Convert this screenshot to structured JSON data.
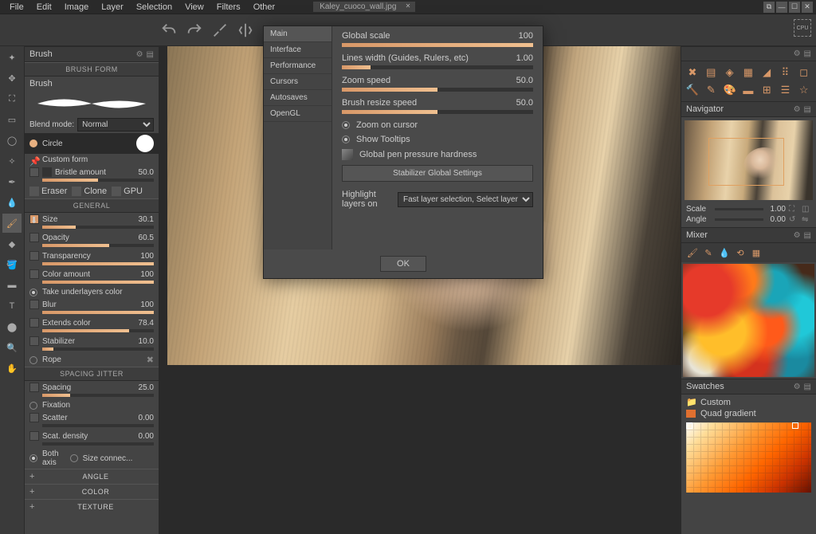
{
  "menu": {
    "items": [
      "File",
      "Edit",
      "Image",
      "Layer",
      "Selection",
      "View",
      "Filters",
      "Other"
    ],
    "tab": "Kaley_cuoco_wall.jpg"
  },
  "leftpanel": {
    "title": "Brush",
    "section_form": "BRUSH FORM",
    "subhead": "Brush",
    "blend_label": "Blend mode:",
    "blend_value": "Normal",
    "type_circle": "Circle",
    "type_custom": "Custom form",
    "bristle_label": "Bristle amount",
    "bristle_value": "50.0",
    "eraser": "Eraser",
    "clone": "Clone",
    "gpu": "GPU",
    "section_general": "GENERAL",
    "size": {
      "label": "Size",
      "value": "30.1",
      "fill": 30
    },
    "opacity": {
      "label": "Opacity",
      "value": "60.5",
      "fill": 60
    },
    "transparency": {
      "label": "Transparency",
      "value": "100",
      "fill": 100
    },
    "coloramount": {
      "label": "Color amount",
      "value": "100",
      "fill": 100
    },
    "take_underlayers": "Take underlayers color",
    "blur": {
      "label": "Blur",
      "value": "100",
      "fill": 100
    },
    "extends": {
      "label": "Extends color",
      "value": "78.4",
      "fill": 78
    },
    "stabilizer": {
      "label": "Stabilizer",
      "value": "10.0",
      "fill": 10
    },
    "rope": "Rope",
    "section_spacing": "SPACING JITTER",
    "spacing": {
      "label": "Spacing",
      "value": "25.0",
      "fill": 25
    },
    "fixation": "Fixation",
    "scatter": {
      "label": "Scatter",
      "value": "0.00",
      "fill": 0
    },
    "scatdensity": {
      "label": "Scat. density",
      "value": "0.00",
      "fill": 0
    },
    "both_axis": "Both axis",
    "size_conn": "Size connec...",
    "angle": "ANGLE",
    "color": "COLOR",
    "texture": "TEXTURE"
  },
  "prefs": {
    "tabs": [
      "Main",
      "Interface",
      "Performance",
      "Cursors",
      "Autosaves",
      "OpenGL"
    ],
    "global_scale": {
      "label": "Global scale",
      "value": "100",
      "fill": 100
    },
    "lines_width": {
      "label": "Lines width (Guides, Rulers, etc)",
      "value": "1.00",
      "fill": 15
    },
    "zoom_speed": {
      "label": "Zoom speed",
      "value": "50.0",
      "fill": 50
    },
    "brush_resize": {
      "label": "Brush resize speed",
      "value": "50.0",
      "fill": 50
    },
    "zoom_cursor": "Zoom on cursor",
    "show_tooltips": "Show Tooltips",
    "pen_hardness": "Global pen pressure hardness",
    "stabilizer_btn": "Stabilizer Global Settings",
    "highlight_label": "Highlight layers on",
    "highlight_value": "Fast layer selection, Select layer",
    "ok": "OK"
  },
  "right": {
    "navigator": "Navigator",
    "scale": {
      "label": "Scale",
      "value": "1.00",
      "fill": 30
    },
    "angle_nav": {
      "label": "Angle",
      "value": "0.00",
      "fill": 0
    },
    "mixer": "Mixer",
    "swatches": "Swatches",
    "custom": "Custom",
    "quad": "Quad gradient"
  },
  "cpu": "CPU"
}
